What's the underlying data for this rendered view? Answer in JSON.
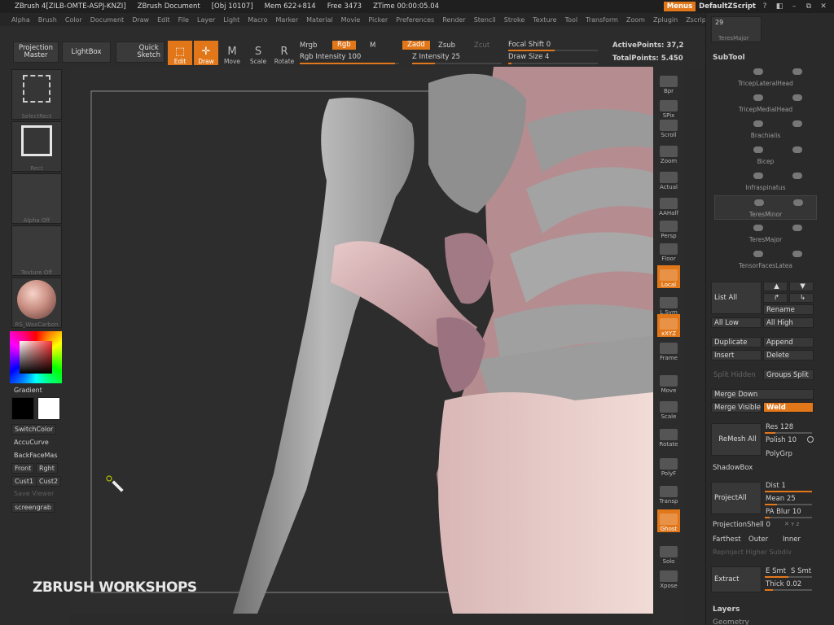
{
  "titlebar": {
    "app": "ZBrush 4[ZILB-OMTE-ASPJ-KNZI]",
    "doc": "ZBrush Document",
    "obj": "[Obj 10107]",
    "mem": "Mem 622+814",
    "free": "Free 3473",
    "ztime": "ZTime 00:00:05.04",
    "menus_btn": "Menus",
    "script": "DefaultZScript"
  },
  "menubar": [
    "Alpha",
    "Brush",
    "Color",
    "Document",
    "Draw",
    "Edit",
    "File",
    "Layer",
    "Light",
    "Macro",
    "Marker",
    "Material",
    "Movie",
    "Picker",
    "Preferences",
    "Render",
    "Stencil",
    "Stroke",
    "Texture",
    "Tool",
    "Transform",
    "Zoom",
    "Zplugin",
    "Zscript"
  ],
  "shelf": {
    "projection_master": "Projection\nMaster",
    "lightbox": "LightBox",
    "quick_sketch": "Quick\nSketch",
    "edit": "Edit",
    "draw": "Draw",
    "move": "Move",
    "scale": "Scale",
    "rotate": "Rotate",
    "mrgb": "Mrgb",
    "rgb": "Rgb",
    "m": "M",
    "rgb_intensity": "Rgb Intensity 100",
    "zadd": "Zadd",
    "zsub": "Zsub",
    "zcut": "Zcut",
    "z_intensity": "Z Intensity 25",
    "focal_shift": "Focal Shift 0",
    "draw_size": "Draw Size 4",
    "active_points": "ActivePoints: 37,2",
    "total_points": "TotalPoints: 5.450"
  },
  "left": {
    "select_rect": "SelectRect",
    "rect": "Rect",
    "alpha_off": "Alpha Off",
    "texture_off": "Texture Off",
    "material": "RS_WaxCarbon",
    "gradient": "Gradient",
    "switch_color": "SwitchColor",
    "accu_curve": "AccuCurve",
    "backface": "BackFaceMas",
    "front": "Front",
    "right": "Rght",
    "cust1": "Cust1",
    "cust2": "Cust2",
    "save_viewer": "Save Viewer",
    "screengrab": "screengrab"
  },
  "canvas": {
    "watermark": "ZBRUSH WORKSHOPS"
  },
  "viewtools": [
    {
      "label": "Bpr"
    },
    {
      "label": "SPix"
    },
    {
      "label": "Scroll"
    },
    {
      "label": "Zoom"
    },
    {
      "label": "Actual"
    },
    {
      "label": "AAHalf"
    },
    {
      "label": "Persp"
    },
    {
      "label": "Floor"
    },
    {
      "label": "Local"
    },
    {
      "label": "L.Sym"
    },
    {
      "label": "xXYZ"
    },
    {
      "label": "Frame"
    },
    {
      "label": "Move"
    },
    {
      "label": "Scale"
    },
    {
      "label": "Rotate"
    },
    {
      "label": "PolyF"
    },
    {
      "label": "Transp"
    },
    {
      "label": "Ghost"
    },
    {
      "label": "Solo"
    },
    {
      "label": "Xpose"
    }
  ],
  "palette": {
    "top_count": "29",
    "top_name": "TeresMajor",
    "subtool_title": "SubTool",
    "subtools": [
      "TricepLateralHead",
      "TricepMedialHead",
      "Brachialis",
      "Bicep",
      "Infraspinatus",
      "TeresMinor",
      "TeresMajor",
      "TensorFacesLatea"
    ],
    "list_all": "List All",
    "rename": "Rename",
    "all_low": "All Low",
    "all_high": "All High",
    "duplicate": "Duplicate",
    "append": "Append",
    "insert": "Insert",
    "delete": "Delete",
    "split_hidden": "Split Hidden",
    "groups_split": "Groups Split",
    "merge_down": "Merge Down",
    "merge_visible": "Merge Visible",
    "weld": "Weld",
    "remesh_all": "ReMesh  All",
    "res": "Res 128",
    "polish": "Polish 10",
    "polygrp": "PolyGrp",
    "shadowbox": "ShadowBox",
    "project_all": "ProjectAll",
    "dist": "Dist 1",
    "mean": "Mean 25",
    "pa_blur": "PA Blur 10",
    "projection_shell": "ProjectionShell 0",
    "farthest": "Farthest",
    "outer": "Outer",
    "inner": "Inner",
    "reproject": "Reproject Higher Subdiv",
    "extract": "Extract",
    "e_smt": "E Smt",
    "s_smt": "S Smt",
    "thick": "Thick 0.02",
    "layers": "Layers",
    "geometry": "Geometry"
  }
}
